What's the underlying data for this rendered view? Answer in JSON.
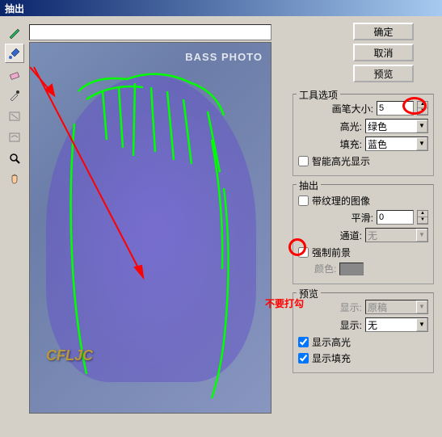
{
  "window": {
    "title": "抽出"
  },
  "watermark": {
    "top": "BASS PHOTO",
    "bottom": "CFLJC"
  },
  "buttons": {
    "ok": "确定",
    "cancel": "取消",
    "preview": "预览"
  },
  "toolOptions": {
    "title": "工具选项",
    "brushSize": {
      "label": "画笔大小:",
      "value": "5"
    },
    "highlight": {
      "label": "高光:",
      "value": "绿色"
    },
    "fill": {
      "label": "填充:",
      "value": "蓝色"
    },
    "smartHighlight": "智能高光显示"
  },
  "extract": {
    "title": "抽出",
    "textured": "带纹理的图像",
    "smooth": {
      "label": "平滑:",
      "value": "0"
    },
    "channel": {
      "label": "通道:",
      "value": "无"
    },
    "forceFg": "强制前景",
    "color": "颜色:"
  },
  "preview": {
    "title": "预览",
    "showOriginal": {
      "label": "显示:",
      "value": "原稿"
    },
    "showAs": {
      "label": "显示:",
      "value": "无"
    },
    "showHighlight": "显示高光",
    "showFill": "显示填充"
  },
  "annotations": {
    "dontCheck": "不要打勾"
  }
}
